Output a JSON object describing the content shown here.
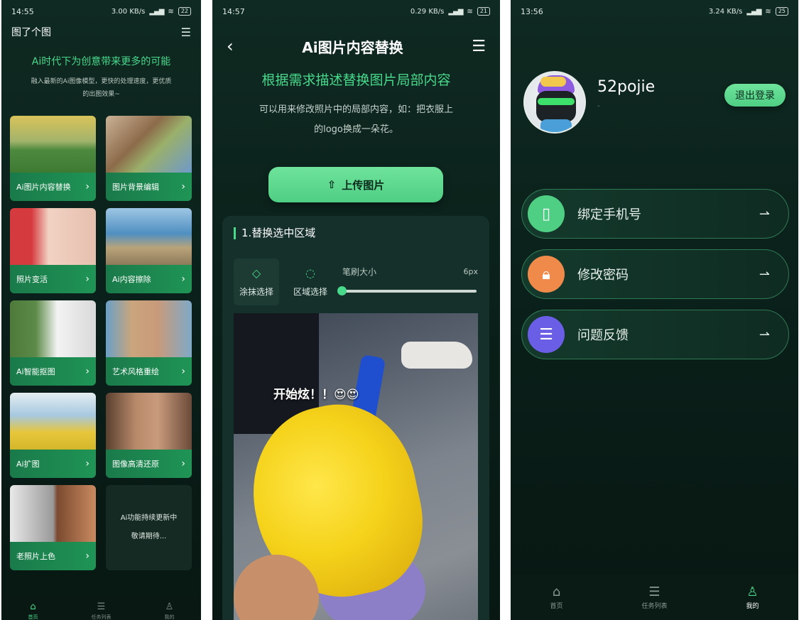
{
  "phone1": {
    "status": {
      "time": "14:55",
      "net": "3.00 KB/s",
      "battery": "22"
    },
    "header": {
      "title": "图了个图"
    },
    "slogan": "Ai时代下为创意带来更多的可能",
    "desc": "融入最新的Ai图像模型，更快的处理速度，更优质的出图效果~",
    "cards": [
      {
        "label": "Ai图片内容替换"
      },
      {
        "label": "图片背景编辑"
      },
      {
        "label": "照片变活"
      },
      {
        "label": "Ai内容擦除"
      },
      {
        "label": "Ai智能抠图"
      },
      {
        "label": "艺术风格重绘"
      },
      {
        "label": "Ai扩图"
      },
      {
        "label": "图像高清还原"
      },
      {
        "label": "老照片上色"
      }
    ],
    "more_card": {
      "line1": "Ai功能持续更新中",
      "line2": "敬请期待..."
    },
    "tabs": [
      {
        "label": "首页"
      },
      {
        "label": "任务列表"
      },
      {
        "label": "我的"
      }
    ]
  },
  "phone2": {
    "status": {
      "time": "14:57",
      "net": "0.29 KB/s",
      "battery": "21"
    },
    "nav": {
      "title": "Ai图片内容替换"
    },
    "heading": "根据需求描述替换图片局部内容",
    "desc": "可以用来修改照片中的局部内容，如：把衣服上的logo换成一朵花。",
    "upload_label": "上传图片",
    "panel": {
      "title": "1.替换选中区域",
      "tool_paint": "涂抹选择",
      "tool_region": "区域选择",
      "brush_label": "笔刷大小",
      "brush_value": "6px",
      "brush_fraction": 0.0
    },
    "photo_overlay": "开始炫！！😍😍"
  },
  "phone3": {
    "status": {
      "time": "13:56",
      "net": "3.24 KB/s",
      "battery": "25"
    },
    "username": "52pojie",
    "subtitle": "-",
    "logout_label": "退出登录",
    "menu": [
      {
        "label": "绑定手机号",
        "icon": "phone-icon",
        "color": "#4fcf84"
      },
      {
        "label": "修改密码",
        "icon": "lock-icon",
        "color": "#f08a4b"
      },
      {
        "label": "问题反馈",
        "icon": "chat-icon",
        "color": "#6b5ee6"
      }
    ],
    "tabs": [
      {
        "label": "首页"
      },
      {
        "label": "任务列表"
      },
      {
        "label": "我的"
      }
    ]
  },
  "colors": {
    "accent": "#49d98b",
    "background": "#0b211b"
  }
}
